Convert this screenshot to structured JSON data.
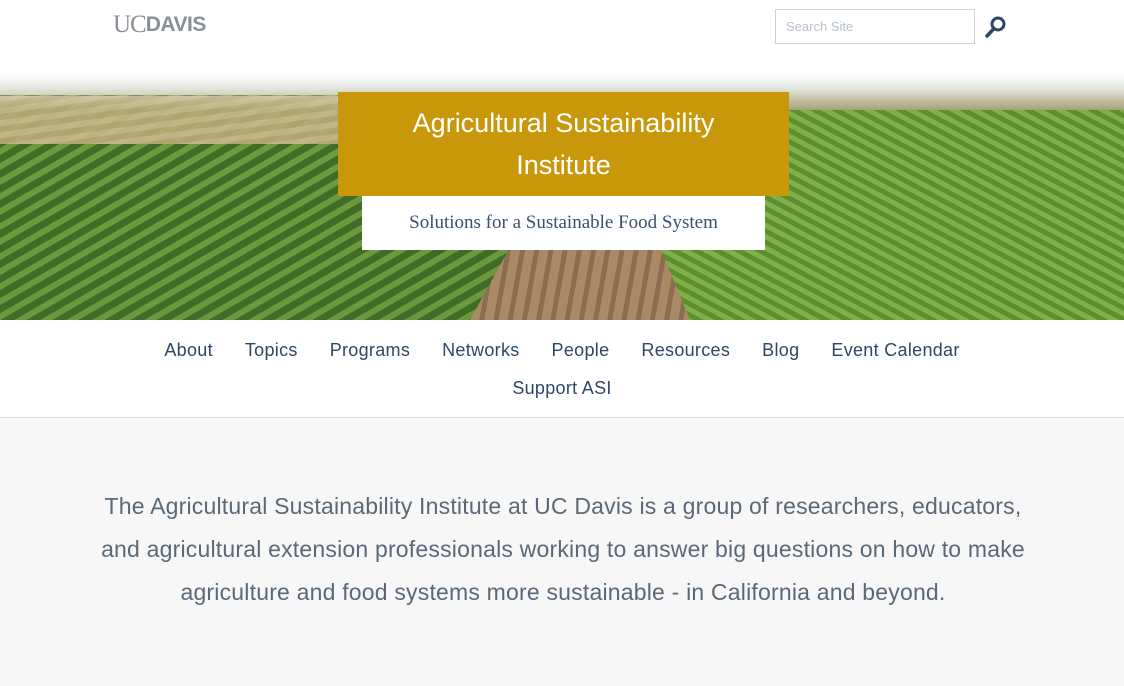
{
  "header": {
    "logo_uc": "UC",
    "logo_davis": "DAVIS",
    "search_placeholder": "Search Site",
    "search_icon": "search-icon"
  },
  "hero": {
    "title": "Agricultural Sustainability Institute",
    "tagline": "Solutions for a Sustainable Food System"
  },
  "nav": {
    "row1": [
      "About",
      "Topics",
      "Programs",
      "Networks",
      "People",
      "Resources",
      "Blog",
      "Event Calendar"
    ],
    "row2": [
      "Support ASI"
    ]
  },
  "intro": {
    "text": "The Agricultural Sustainability Institute at UC Davis is a group of researchers, educators, and agricultural extension professionals working to answer big questions on how to make agriculture and food systems more sustainable - in California and beyond."
  },
  "colors": {
    "title_bg": "#c9980a",
    "nav_text": "#2f4666",
    "body_text": "#5a6878"
  }
}
